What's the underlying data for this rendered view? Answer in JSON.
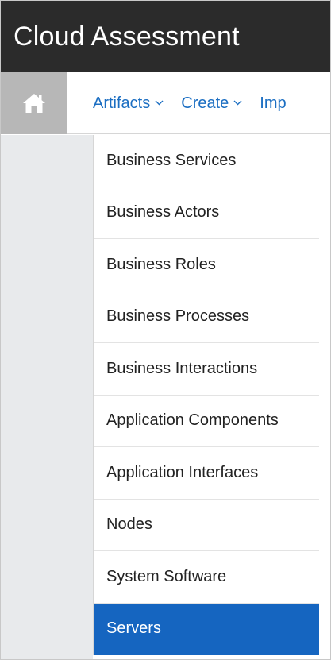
{
  "app": {
    "title": "Cloud Assessment"
  },
  "nav": {
    "home_icon": "home-icon",
    "items": [
      {
        "label": "Artifacts",
        "has_dropdown": true
      },
      {
        "label": "Create",
        "has_dropdown": true
      },
      {
        "label": "Imp",
        "has_dropdown": false
      }
    ]
  },
  "menu": {
    "items": [
      {
        "label": "Business Services"
      },
      {
        "label": "Business Actors"
      },
      {
        "label": "Business Roles"
      },
      {
        "label": "Business Processes"
      },
      {
        "label": "Business Interactions"
      },
      {
        "label": "Application Components"
      },
      {
        "label": "Application Interfaces"
      },
      {
        "label": "Nodes"
      },
      {
        "label": "System Software"
      },
      {
        "label": "Servers",
        "selected": true
      }
    ]
  },
  "colors": {
    "titlebar_bg": "#2b2b2b",
    "home_bg": "#b7b7b7",
    "nav_link": "#1b6ec2",
    "selected_bg": "#1565c0",
    "left_pane_bg": "#e8eaec"
  }
}
